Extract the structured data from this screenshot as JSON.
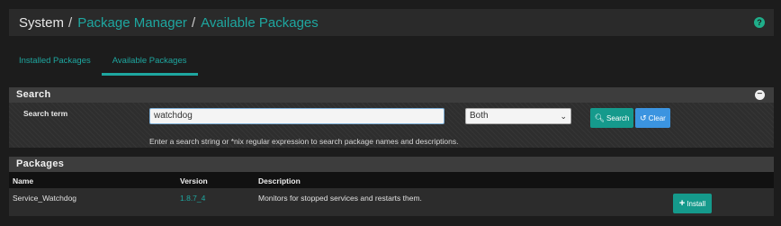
{
  "breadcrumb": {
    "system": "System",
    "separator": "/",
    "package_manager": "Package Manager",
    "current": "Available Packages",
    "help_icon": "?"
  },
  "tabs": [
    {
      "label": "Installed Packages",
      "active": false
    },
    {
      "label": "Available Packages",
      "active": true
    }
  ],
  "search_panel": {
    "title": "Search",
    "collapse_icon": "−",
    "term_label": "Search term",
    "term_value": "watchdog",
    "scope_selected": "Both",
    "search_button": "Search",
    "clear_button": "Clear",
    "help_text": "Enter a search string or *nix regular expression to search package names and descriptions."
  },
  "packages_panel": {
    "title": "Packages",
    "columns": [
      "Name",
      "Version",
      "Description"
    ],
    "rows": [
      {
        "name": "Service_Watchdog",
        "version": "1.8.7_4",
        "description": "Monitors for stopped services and restarts them.",
        "action": "Install"
      }
    ]
  },
  "colors": {
    "accent": "#1ea7a0",
    "button_primary": "#159a8c",
    "button_info": "#3b94e0",
    "background": "#1c1c1c"
  }
}
